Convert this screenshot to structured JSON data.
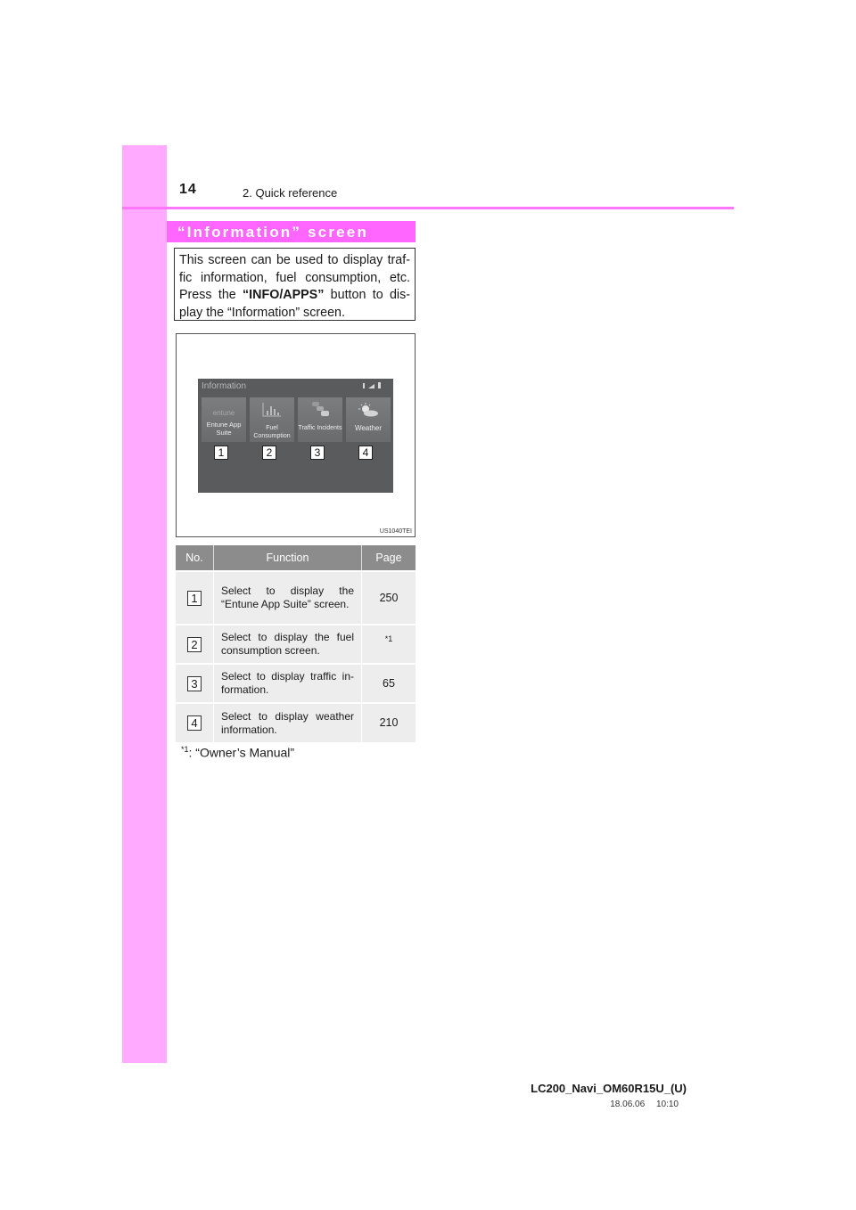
{
  "header": {
    "page_number": "14",
    "chapter": "2. Quick reference"
  },
  "section": {
    "title": "“Information” screen",
    "intro_part1": "This screen can be used to display traf-fic information, fuel consumption, etc. Press the ",
    "intro_bold": "“INFO/APPS”",
    "intro_part2": " button to dis-play the “Information” screen."
  },
  "figure": {
    "code": "US1040TEI",
    "screen_title": "Information",
    "tiles": [
      {
        "icon": "entune-logo-icon",
        "icon_text": "entune",
        "label": "Entune App Suite",
        "badge": "1"
      },
      {
        "icon": "bar-chart-icon",
        "icon_text": "",
        "label": "Fuel Consumption",
        "badge": "2"
      },
      {
        "icon": "traffic-cars-icon",
        "icon_text": "",
        "label": "Traffic Incidents",
        "badge": "3"
      },
      {
        "icon": "weather-sun-cloud-icon",
        "icon_text": "",
        "label": "Weather",
        "badge": "4"
      }
    ]
  },
  "table": {
    "headers": [
      "No.",
      "Function",
      "Page"
    ],
    "rows": [
      {
        "no": "1",
        "function": "Select to display the “Entune App Suite” screen.",
        "page": "250"
      },
      {
        "no": "2",
        "function": "Select to display the fuel consumption screen.",
        "page": "*1"
      },
      {
        "no": "3",
        "function": "Select to display traffic in-formation.",
        "page": "65"
      },
      {
        "no": "4",
        "function": "Select to display weather information.",
        "page": "210"
      }
    ]
  },
  "footnote": {
    "marker": "*1",
    "text": ": “Owner’s Manual”"
  },
  "footer": {
    "doc_id": "LC200_Navi_OM60R15U_(U)",
    "date": "18.06.06",
    "time": "10:10"
  },
  "colors": {
    "accent_pink": "#ff66ff",
    "side_tab": "#ffaaff",
    "table_header": "#8c8c8c",
    "table_row": "#ededed"
  }
}
